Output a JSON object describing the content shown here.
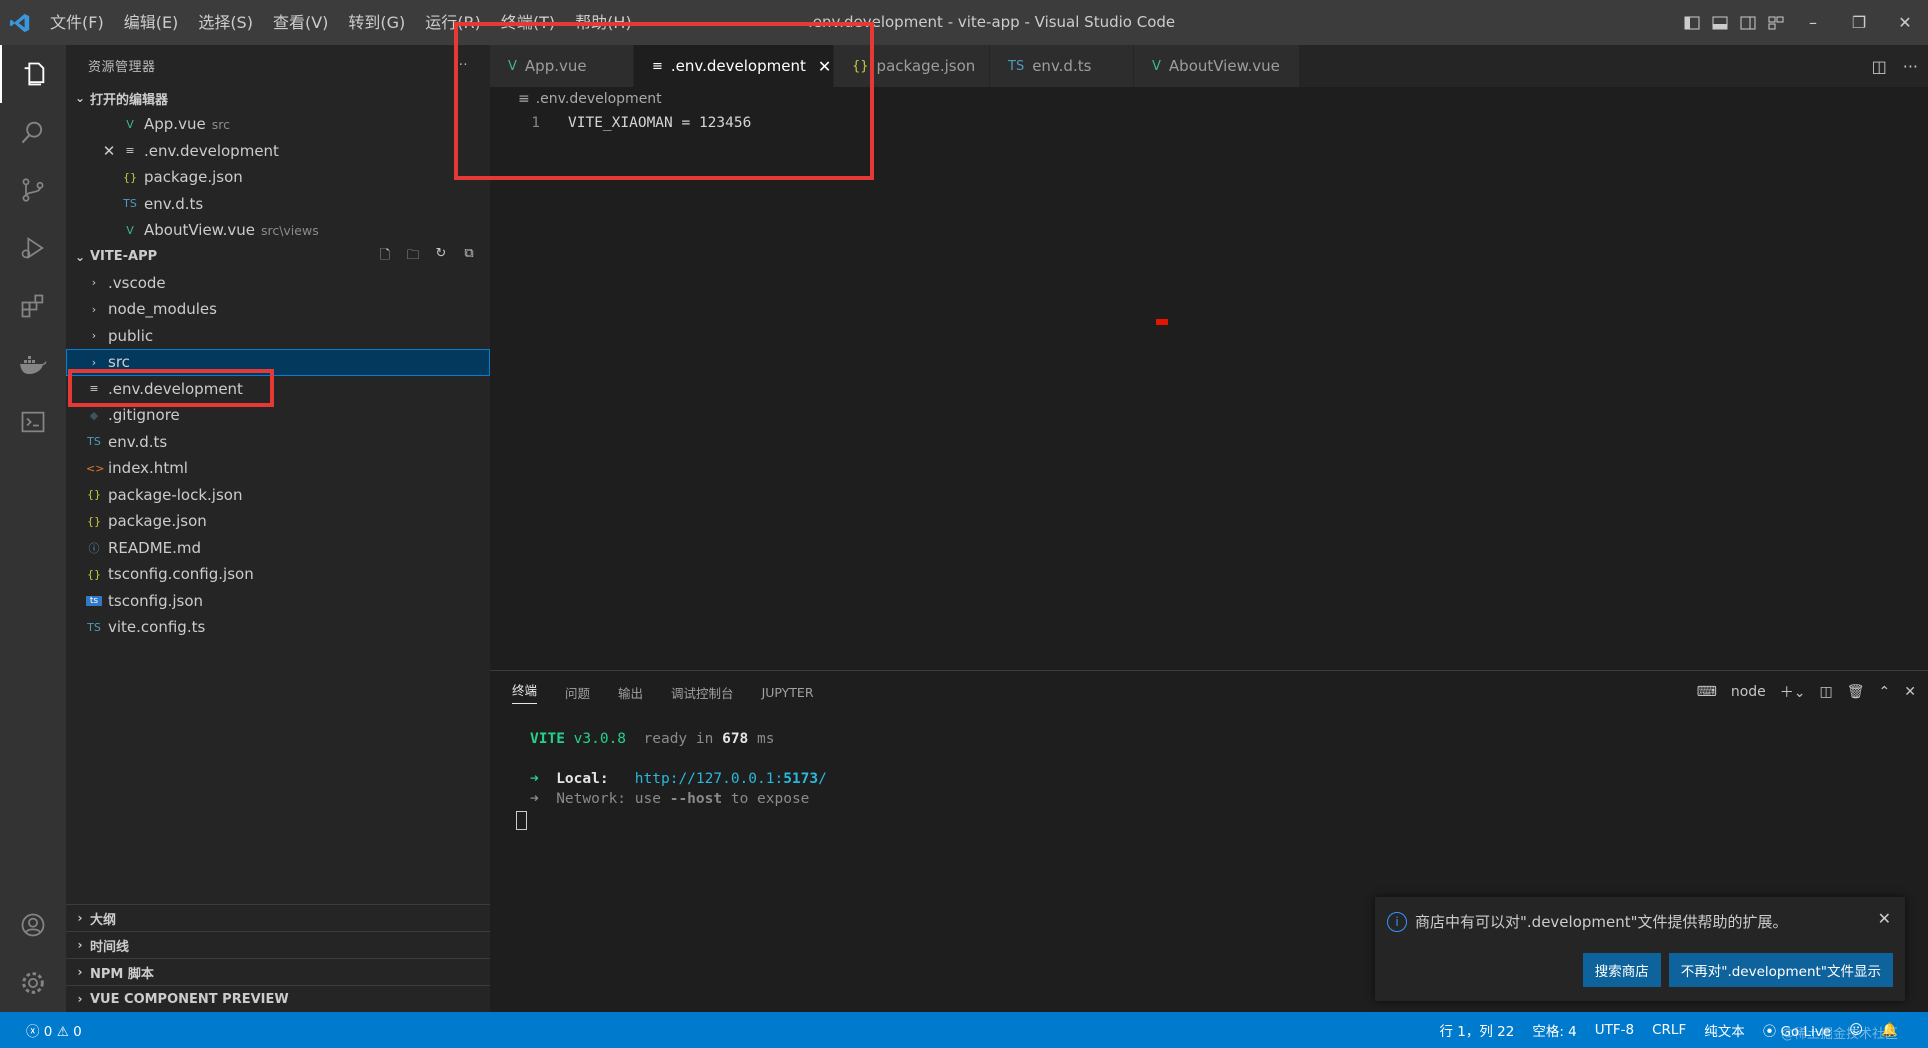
{
  "window": {
    "title": ".env.development - vite-app - Visual Studio Code",
    "menu": [
      "文件(F)",
      "编辑(E)",
      "选择(S)",
      "查看(V)",
      "转到(G)",
      "运行(R)",
      "终端(T)",
      "帮助(H)"
    ]
  },
  "activity_icons": [
    "explorer-icon",
    "search-icon",
    "source-control-icon",
    "run-debug-icon",
    "extensions-icon",
    "docker-icon",
    "terminal-view-icon"
  ],
  "sidebar": {
    "header": "资源管理器",
    "open_editors_title": "打开的编辑器",
    "open_editors": [
      {
        "name": "App.vue",
        "hint": "src",
        "icon": "V"
      },
      {
        "name": ".env.development",
        "hint": "",
        "icon": "≡"
      },
      {
        "name": "package.json",
        "hint": "",
        "icon": "{}"
      },
      {
        "name": "env.d.ts",
        "hint": "",
        "icon": "TS"
      },
      {
        "name": "AboutView.vue",
        "hint": "src\\views",
        "icon": "V"
      }
    ],
    "project_title": "VITE-APP",
    "folders": [
      ".vscode",
      "node_modules",
      "public",
      "src"
    ],
    "files": [
      {
        "name": ".env.development",
        "icon": "≡"
      },
      {
        "name": ".gitignore",
        "icon": "◆"
      },
      {
        "name": "env.d.ts",
        "icon": "TS"
      },
      {
        "name": "index.html",
        "icon": "<>"
      },
      {
        "name": "package-lock.json",
        "icon": "{}"
      },
      {
        "name": "package.json",
        "icon": "{}"
      },
      {
        "name": "README.md",
        "icon": "ⓘ"
      },
      {
        "name": "tsconfig.config.json",
        "icon": "{}"
      },
      {
        "name": "tsconfig.json",
        "icon": "ts"
      },
      {
        "name": "vite.config.ts",
        "icon": "TS"
      }
    ],
    "bottom_sections": [
      "大纲",
      "时间线",
      "NPM 脚本",
      "VUE COMPONENT PREVIEW"
    ]
  },
  "editor": {
    "tabs": [
      {
        "label": "App.vue",
        "icon": "V"
      },
      {
        "label": ".env.development",
        "icon": "≡"
      },
      {
        "label": "package.json",
        "icon": "{}"
      },
      {
        "label": "env.d.ts",
        "icon": "TS"
      },
      {
        "label": "AboutView.vue",
        "icon": "V"
      }
    ],
    "breadcrumb": ".env.development",
    "lines": [
      {
        "n": "1",
        "text": "VITE_XIAOMAN = 123456"
      }
    ]
  },
  "panel": {
    "tabs": [
      "终端",
      "问题",
      "输出",
      "调试控制台",
      "JUPYTER"
    ],
    "shell": "node",
    "terminal": {
      "vite": "VITE",
      "version": "v3.0.8",
      "ready": "ready in",
      "ms_value": "678",
      "ms": "ms",
      "local_label": "Local:",
      "local_url_prefix": "http://127.0.0.1:",
      "local_port": "5173",
      "local_url_suffix": "/",
      "network_label": "Network:",
      "network_use": "use",
      "network_flag": "--host",
      "network_rest": "to expose"
    }
  },
  "notification": {
    "message": "商店中有可以对\".development\"文件提供帮助的扩展。",
    "primary": "搜索商店",
    "secondary": "不再对\".development\"文件显示"
  },
  "statusbar": {
    "errors": "0",
    "warnings": "0",
    "position": "行 1，列 22",
    "spaces": "空格: 4",
    "encoding": "UTF-8",
    "eol": "CRLF",
    "language": "纯文本",
    "golive": "Go Live"
  },
  "watermark": "@稀土掘金技术社区"
}
